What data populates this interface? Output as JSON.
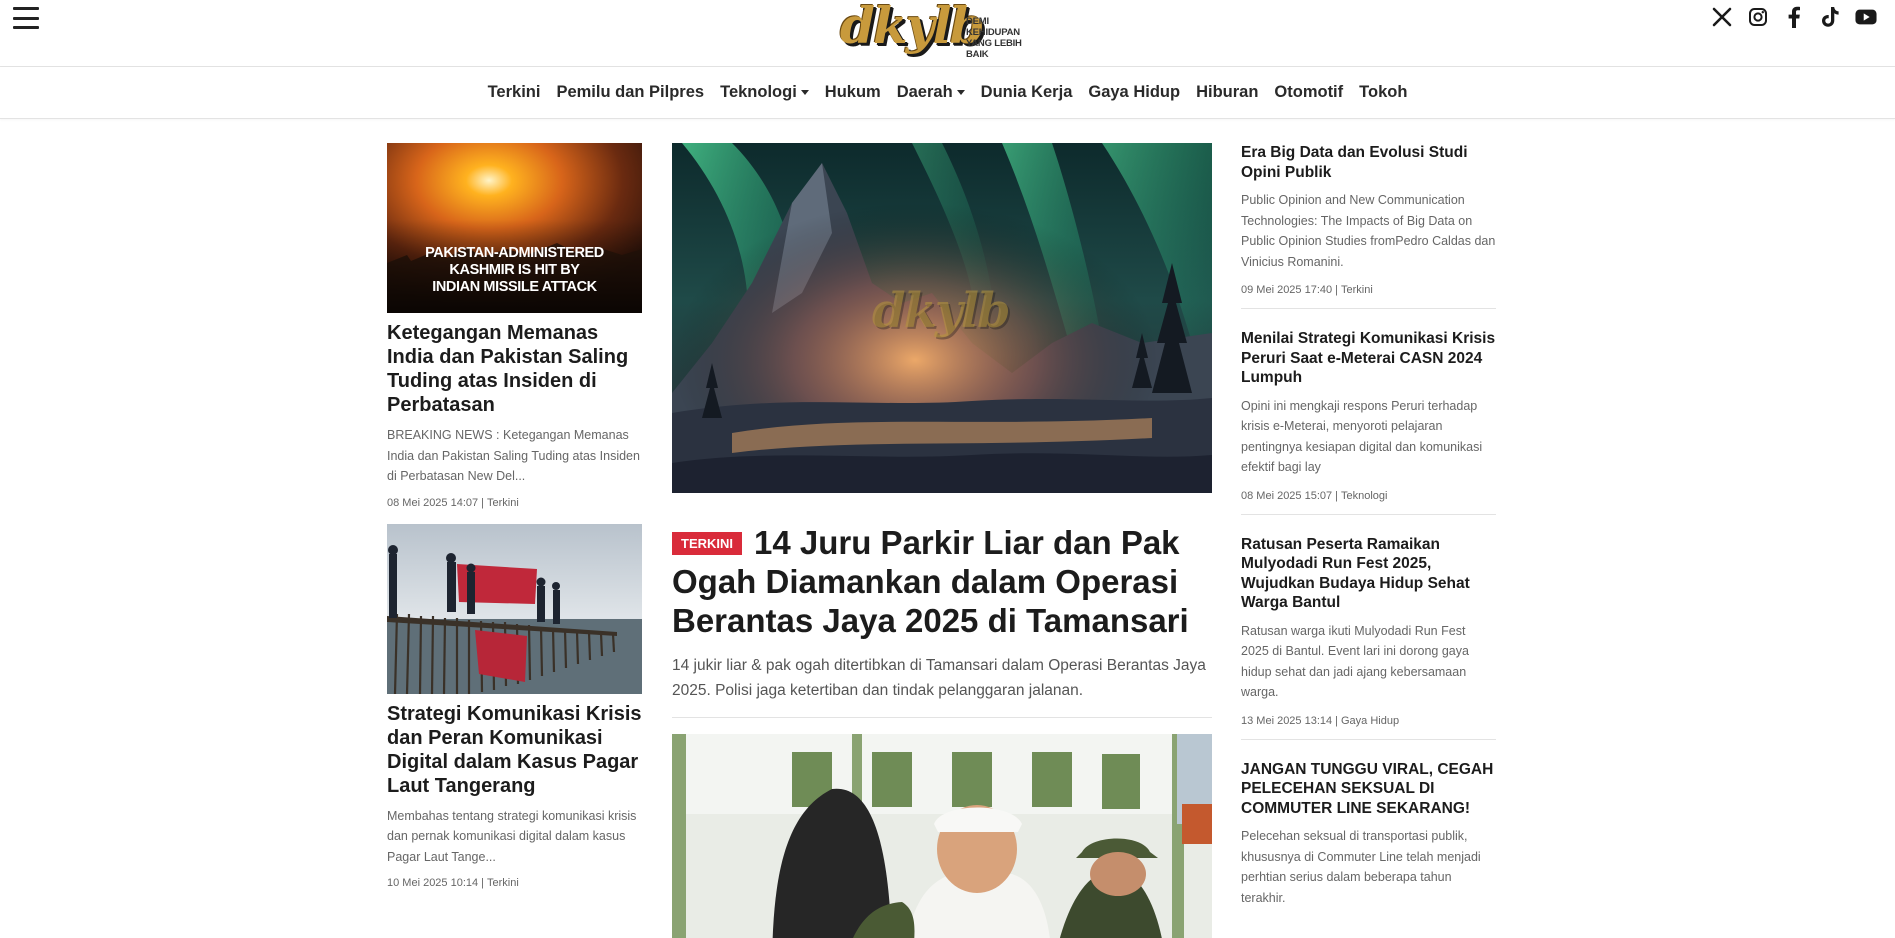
{
  "header": {
    "logo_text": "dkylb",
    "tagline_line1": "DEMI KEHIDUPAN",
    "tagline_line2": "YANG LEBIH BAIK",
    "menu_icon": "hamburger-menu-icon",
    "socials": [
      "x-icon",
      "instagram-icon",
      "facebook-icon",
      "tiktok-icon",
      "youtube-icon"
    ]
  },
  "nav": {
    "items": [
      {
        "label": "Terkini",
        "dropdown": false
      },
      {
        "label": "Pemilu dan Pilpres",
        "dropdown": false
      },
      {
        "label": "Teknologi",
        "dropdown": true
      },
      {
        "label": "Hukum",
        "dropdown": false
      },
      {
        "label": "Daerah",
        "dropdown": true
      },
      {
        "label": "Dunia Kerja",
        "dropdown": false
      },
      {
        "label": "Gaya Hidup",
        "dropdown": false
      },
      {
        "label": "Hiburan",
        "dropdown": false
      },
      {
        "label": "Otomotif",
        "dropdown": false
      },
      {
        "label": "Tokoh",
        "dropdown": false
      }
    ]
  },
  "left": {
    "articles": [
      {
        "image_caption": "PAKISTAN-ADMINISTERED KASHMIR IS HIT BY INDIAN MISSILE ATTACK",
        "image_caption_lines": [
          "PAKISTAN-ADMINISTERED",
          "KASHMIR IS HIT BY",
          "INDIAN MISSILE ATTACK"
        ],
        "title": "Ketegangan Memanas India dan Pakistan Saling Tuding atas Insiden di Perbatasan",
        "excerpt": "BREAKING NEWS : Ketegangan Memanas India dan Pakistan Saling Tuding atas Insiden di Perbatasan New Del...",
        "date": "08 Mei 2025 14:07",
        "category": "Terkini"
      },
      {
        "title": "Strategi Komunikasi Krisis dan Peran Komunikasi Digital dalam Kasus Pagar Laut Tangerang",
        "excerpt": "Membahas tentang strategi komunikasi krisis dan pernak komunikasi digital dalam kasus Pagar Laut Tange...",
        "date": "10 Mei 2025 10:14",
        "category": "Terkini"
      }
    ]
  },
  "main": {
    "hero": {
      "watermark": "dkylb",
      "badge": "TERKINI",
      "title": "14 Juru Parkir Liar dan Pak Ogah Diamankan dalam Operasi Berantas Jaya 2025 di Tamansari",
      "excerpt": "14 jukir liar & pak ogah ditertibkan di Tamansari dalam Operasi Berantas Jaya 2025. Polisi jaga ketertiban dan tindak pelanggaran jalanan."
    }
  },
  "right": {
    "articles": [
      {
        "title": "Era Big Data dan Evolusi Studi Opini Publik",
        "excerpt": "Public Opinion and New Communication Technologies: The Impacts of Big Data on Public Opinion Studies fromPedro Caldas dan Vinicius Romanini.",
        "date": "09 Mei 2025 17:40",
        "category": "Terkini"
      },
      {
        "title": "Menilai Strategi Komunikasi Krisis Peruri Saat e-Meterai CASN 2024 Lumpuh",
        "excerpt": "Opini ini mengkaji respons Peruri terhadap krisis e-Meterai, menyoroti pelajaran pentingnya kesiapan digital dan komunikasi efektif bagi lay",
        "date": "08 Mei 2025 15:07",
        "category": "Teknologi"
      },
      {
        "title": "Ratusan Peserta Ramaikan Mulyodadi Run Fest 2025, Wujudkan Budaya Hidup Sehat Warga Bantul",
        "excerpt": "Ratusan warga ikuti Mulyodadi Run Fest 2025 di Bantul. Event lari ini dorong gaya hidup sehat dan jadi ajang kebersamaan warga.",
        "date": "13 Mei 2025 13:14",
        "category": "Gaya Hidup"
      },
      {
        "title": "JANGAN TUNGGU VIRAL, CEGAH PELECEHAN SEKSUAL DI COMMUTER LINE SEKARANG!",
        "excerpt": "Pelecehan seksual di transportasi publik, khususnya di Commuter Line telah menjadi perhtian serius dalam beberapa tahun terakhir."
      }
    ]
  },
  "colors": {
    "badge": "#d92b3a",
    "logo_gold": "#c89a3c",
    "text": "#1c1c1c",
    "muted": "#666666"
  }
}
